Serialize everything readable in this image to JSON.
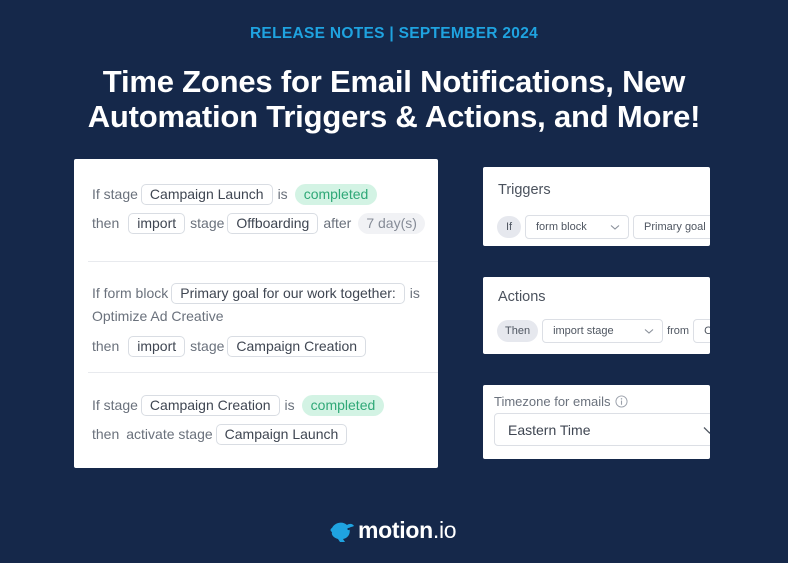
{
  "header": {
    "eyebrow": "RELEASE NOTES | SEPTEMBER 2024",
    "headline_line1": "Time Zones for Email Notifications, New",
    "headline_line2": "Automation Triggers & Actions, and More!"
  },
  "rules": [
    {
      "if_word": "If stage",
      "if_target": "Campaign Launch",
      "is_word": "is",
      "status": "completed",
      "then_word": "then",
      "action": "import",
      "stage_word": "stage",
      "stage_target": "Offboarding",
      "after_word": "after",
      "duration": "7 day(s)"
    },
    {
      "if_word": "If form block",
      "if_target": "Primary goal for our work together:",
      "is_word": "is",
      "value": "Optimize Ad Creative",
      "then_word": "then",
      "action": "import",
      "stage_word": "stage",
      "stage_target": "Campaign Creation"
    },
    {
      "if_word": "If stage",
      "if_target": "Campaign Creation",
      "is_word": "is",
      "status": "completed",
      "then_word": "then",
      "action_text": "activate stage",
      "stage_target": "Campaign Launch"
    }
  ],
  "triggers": {
    "title": "Triggers",
    "if_chip": "If",
    "type_select": "form block",
    "field_select": "Primary goal"
  },
  "actions": {
    "title": "Actions",
    "then_chip": "Then",
    "action_select": "import stage",
    "from_word": "from",
    "from_select": "O"
  },
  "timezone": {
    "label": "Timezone for emails",
    "selected": "Eastern Time"
  },
  "brand": {
    "name": "motion",
    "tld": ".io",
    "accent": "#1fa3e0",
    "background": "#15284a",
    "status_green": "#2fa877"
  }
}
